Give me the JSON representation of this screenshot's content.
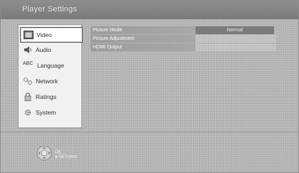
{
  "header": {
    "title": "Player Settings"
  },
  "sidebar": {
    "items": [
      {
        "label": "Video",
        "icon": "video-icon",
        "selected": true
      },
      {
        "label": "Audio",
        "icon": "speaker-icon",
        "selected": false
      },
      {
        "label": "Language",
        "icon": "abc-icon",
        "icon_text": "ABC",
        "selected": false
      },
      {
        "label": "Network",
        "icon": "network-icon",
        "selected": false
      },
      {
        "label": "Ratings",
        "icon": "lock-icon",
        "selected": false
      },
      {
        "label": "System",
        "icon": "gear-icon",
        "selected": false
      }
    ]
  },
  "settings": {
    "rows": [
      {
        "label": "Picture Mode",
        "value": "Normal"
      },
      {
        "label": "Picture Adjustment",
        "value": ""
      },
      {
        "label": "HDMI Output",
        "value": ""
      }
    ]
  },
  "footer": {
    "ok_label": "OK",
    "return_label": "RETURN"
  },
  "colors": {
    "background": "#b3b3b3",
    "title_bar": "#858585",
    "sidebar_bg": "#f1f1f1",
    "value_box": "#7b7b7b"
  }
}
